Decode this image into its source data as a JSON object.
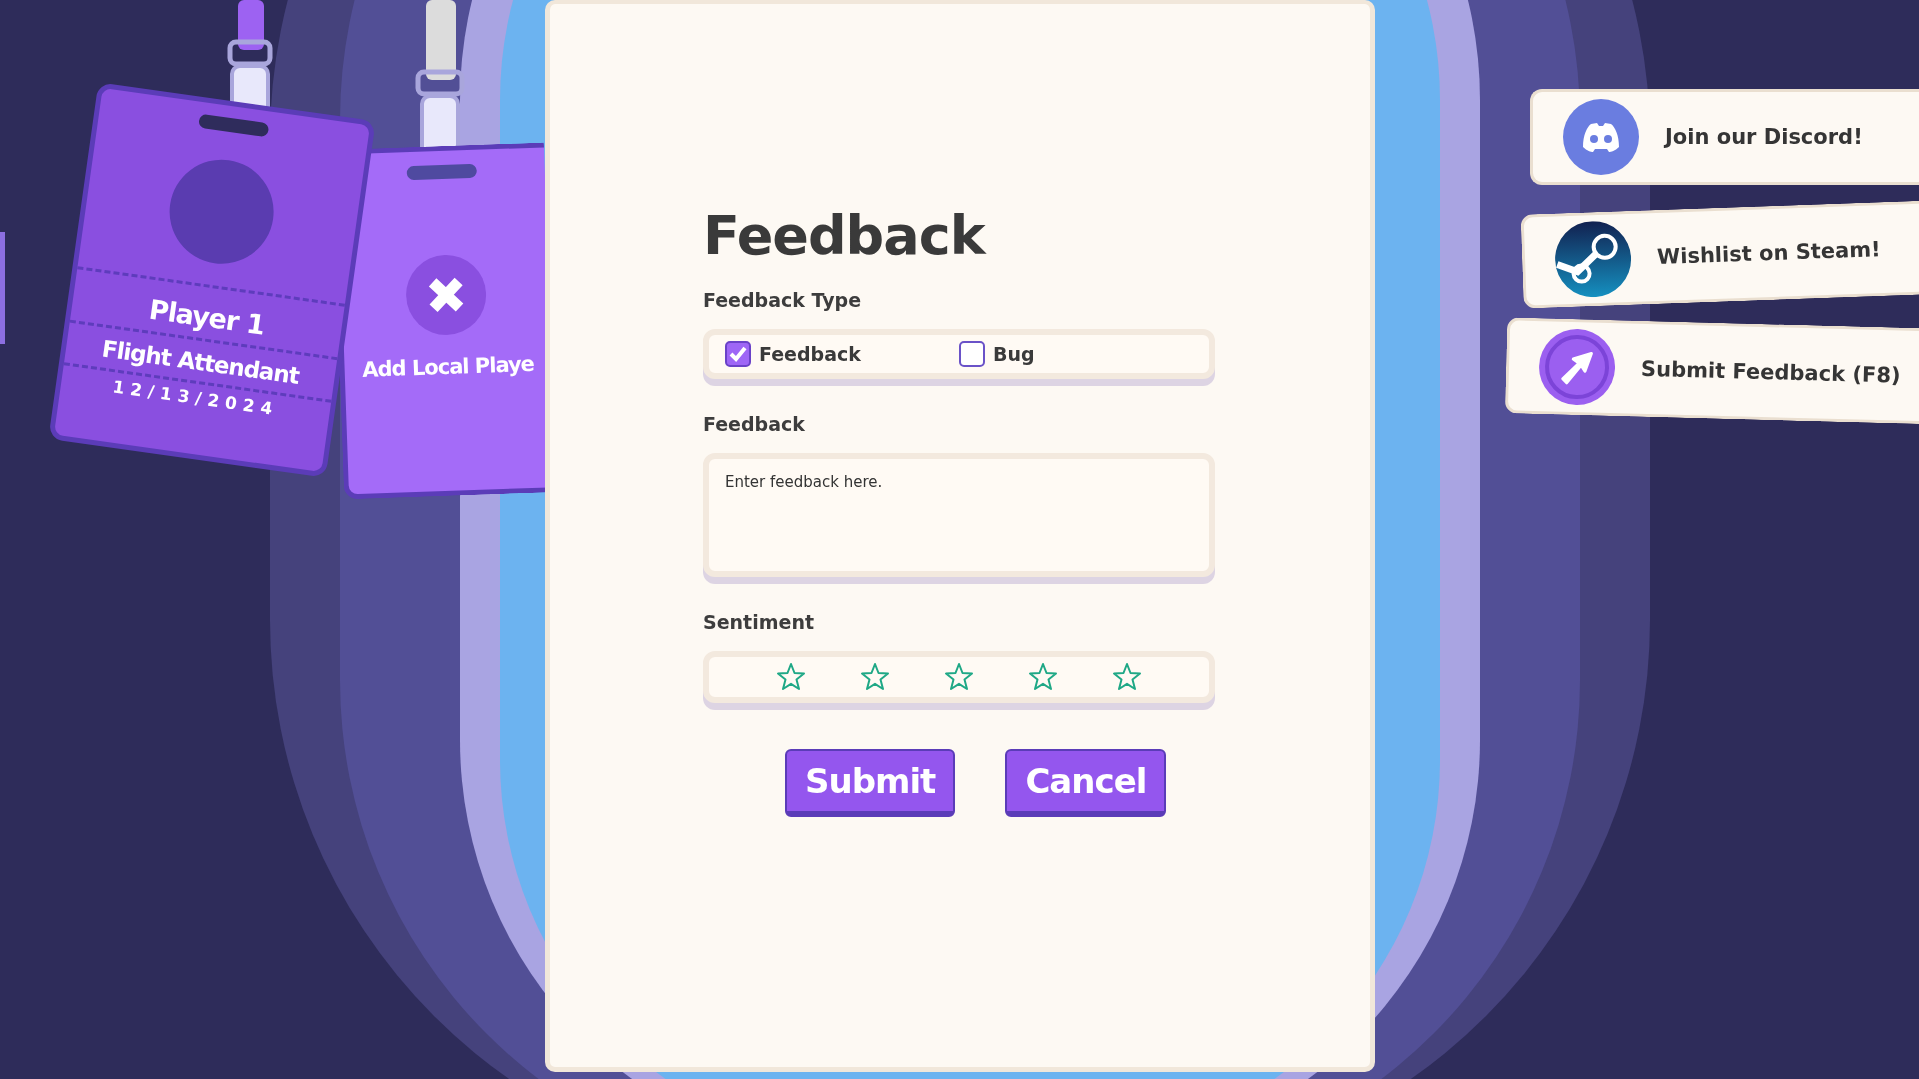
{
  "player_badge": {
    "name": "Player 1",
    "role": "Flight Attendant",
    "date": "12/13/2024"
  },
  "add_player_badge": {
    "label": "Add Local Playe"
  },
  "form": {
    "title": "Feedback",
    "type_label": "Feedback Type",
    "type_options": [
      {
        "label": "Feedback",
        "checked": true
      },
      {
        "label": "Bug",
        "checked": false
      }
    ],
    "feedback_label": "Feedback",
    "feedback_placeholder": "Enter feedback here.",
    "sentiment_label": "Sentiment",
    "sentiment": {
      "stars": 0
    },
    "buttons": [
      {
        "label": "Submit"
      },
      {
        "label": "Cancel"
      }
    ]
  },
  "links": [
    {
      "kind": "discord",
      "label": "Join our Discord!"
    },
    {
      "kind": "steam",
      "label": "Wishlist on Steam!"
    },
    {
      "kind": "feedback",
      "label": "Submit Feedback (F8)"
    }
  ]
}
